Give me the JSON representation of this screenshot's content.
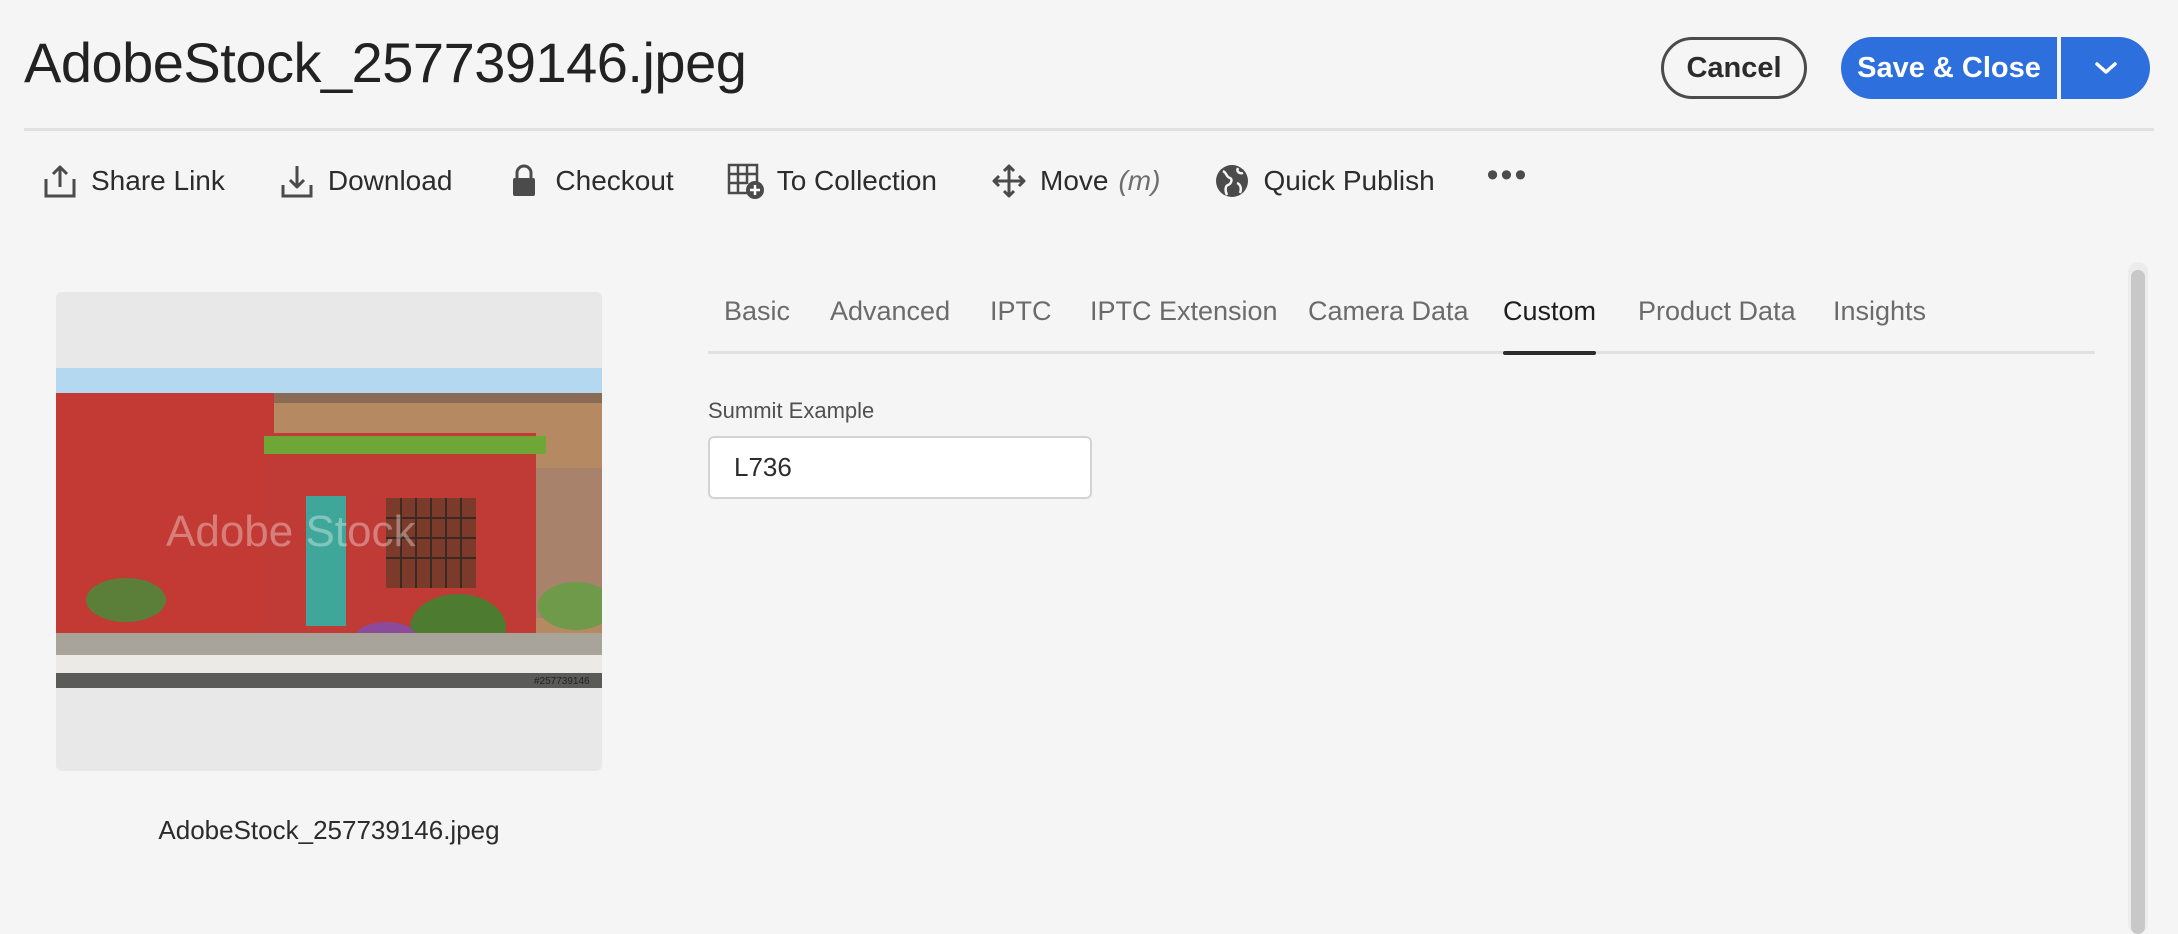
{
  "header": {
    "title": "AdobeStock_257739146.jpeg",
    "cancel_label": "Cancel",
    "save_label": "Save & Close"
  },
  "toolbar": {
    "share_link": "Share Link",
    "download": "Download",
    "checkout": "Checkout",
    "to_collection": "To Collection",
    "move": "Move",
    "move_hint": "(m)",
    "quick_publish": "Quick Publish",
    "more": "•••"
  },
  "preview": {
    "caption": "AdobeStock_257739146.jpeg",
    "watermark": "Adobe Stock",
    "stock_id": "#257739146"
  },
  "tabs": [
    "Basic",
    "Advanced",
    "IPTC",
    "IPTC Extension",
    "Camera Data",
    "Custom",
    "Product Data",
    "Insights"
  ],
  "active_tab": "Custom",
  "form": {
    "field_label": "Summit Example",
    "field_value": "L736"
  },
  "colors": {
    "accent": "#2d6fdc",
    "background": "#f5f5f5"
  }
}
